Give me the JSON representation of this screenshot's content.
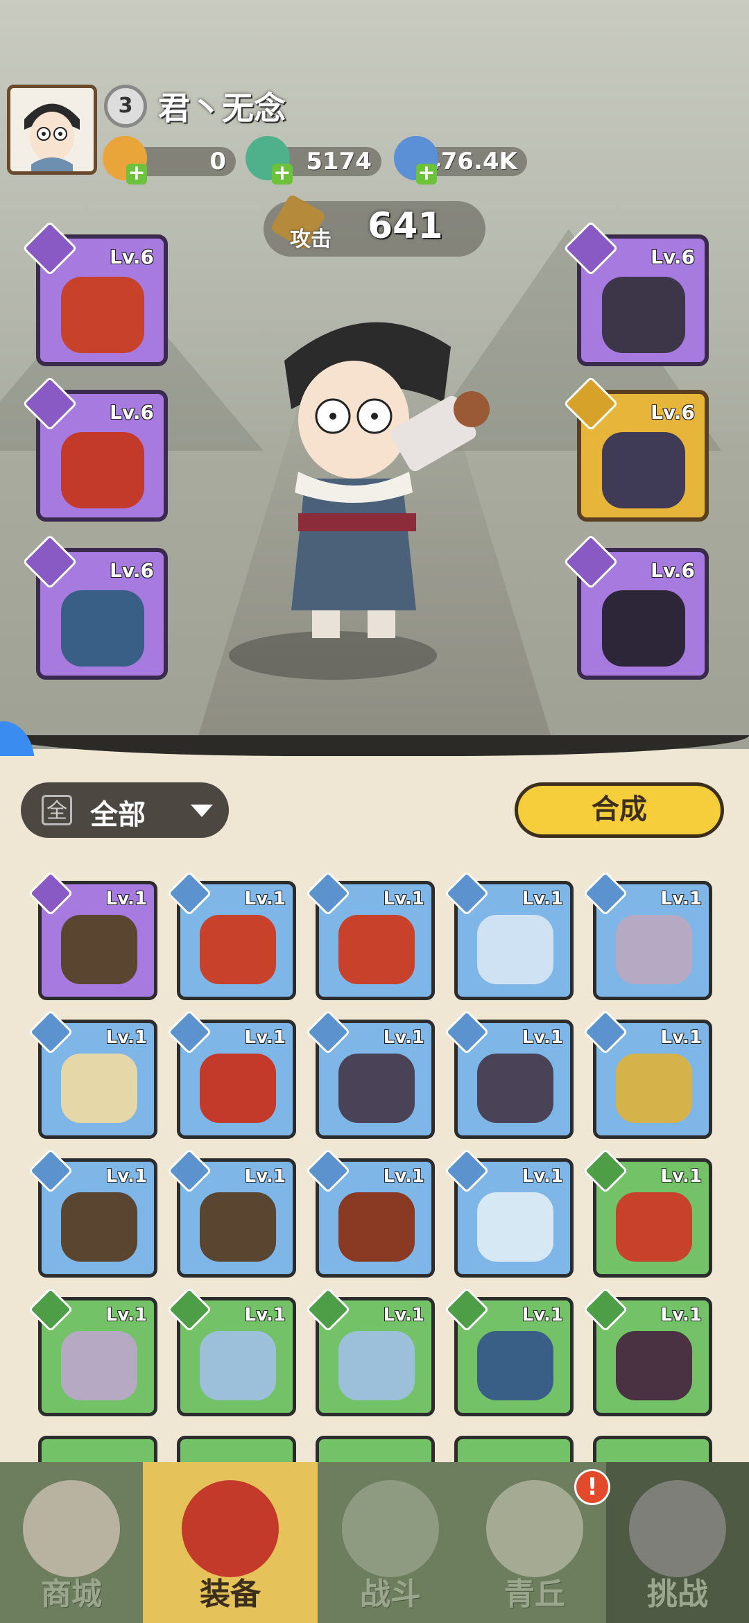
{
  "player": {
    "level": "3",
    "name": "君丶无念"
  },
  "resources": [
    {
      "name": "ticket",
      "value": "0"
    },
    {
      "name": "jade",
      "value": "5174"
    },
    {
      "name": "crystal",
      "value": "476.4K"
    }
  ],
  "attack": {
    "label": "攻击",
    "value": "641"
  },
  "equipped": [
    {
      "slot": "weapon",
      "lv": "Lv.6",
      "rarity": "purple"
    },
    {
      "slot": "helmet",
      "lv": "Lv.6",
      "rarity": "purple"
    },
    {
      "slot": "necklace",
      "lv": "Lv.6",
      "rarity": "purple"
    },
    {
      "slot": "armor",
      "lv": "Lv.6",
      "rarity": "purple"
    },
    {
      "slot": "boots",
      "lv": "Lv.6",
      "rarity": "gold"
    },
    {
      "slot": "ring",
      "lv": "Lv.6",
      "rarity": "purple"
    }
  ],
  "filter": {
    "icon": "全",
    "label": "全部"
  },
  "combine_label": "合成",
  "inventory": [
    {
      "lv": "Lv.1",
      "rarity": "purple",
      "art": "#5a4630"
    },
    {
      "lv": "Lv.1",
      "rarity": "blue",
      "art": "#c8412b"
    },
    {
      "lv": "Lv.1",
      "rarity": "blue",
      "art": "#c8412b"
    },
    {
      "lv": "Lv.1",
      "rarity": "blue",
      "art": "#cfe2f3"
    },
    {
      "lv": "Lv.1",
      "rarity": "blue",
      "art": "#b5a9c4"
    },
    {
      "lv": "Lv.1",
      "rarity": "blue",
      "art": "#e6d7a8"
    },
    {
      "lv": "Lv.1",
      "rarity": "blue",
      "art": "#c33a2b"
    },
    {
      "lv": "Lv.1",
      "rarity": "blue",
      "art": "#4a4256"
    },
    {
      "lv": "Lv.1",
      "rarity": "blue",
      "art": "#4a4256"
    },
    {
      "lv": "Lv.1",
      "rarity": "blue",
      "art": "#d6b24a"
    },
    {
      "lv": "Lv.1",
      "rarity": "blue",
      "art": "#5a4630"
    },
    {
      "lv": "Lv.1",
      "rarity": "blue",
      "art": "#5a4630"
    },
    {
      "lv": "Lv.1",
      "rarity": "blue",
      "art": "#8a3a22"
    },
    {
      "lv": "Lv.1",
      "rarity": "blue",
      "art": "#d7e8f5"
    },
    {
      "lv": "Lv.1",
      "rarity": "green",
      "art": "#c8412b"
    },
    {
      "lv": "Lv.1",
      "rarity": "green",
      "art": "#b5a9c4"
    },
    {
      "lv": "Lv.1",
      "rarity": "green",
      "art": "#9cc0d9"
    },
    {
      "lv": "Lv.1",
      "rarity": "green",
      "art": "#9cc0d9"
    },
    {
      "lv": "Lv.1",
      "rarity": "green",
      "art": "#3a5f86"
    },
    {
      "lv": "Lv.1",
      "rarity": "green",
      "art": "#4a3242"
    }
  ],
  "nav": [
    {
      "label": "商城",
      "icon": "shop-icon",
      "active": false
    },
    {
      "label": "装备",
      "icon": "equipment-icon",
      "active": true
    },
    {
      "label": "战斗",
      "icon": "battle-icon",
      "active": false
    },
    {
      "label": "青丘",
      "icon": "qingqiu-icon",
      "active": false
    },
    {
      "label": "挑战",
      "icon": "challenge-icon",
      "active": false
    }
  ],
  "nav_notice": "!"
}
